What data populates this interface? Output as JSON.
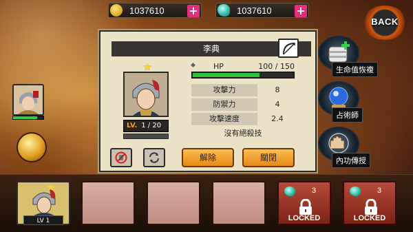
{
  "currency": {
    "gold": {
      "icon": "gold-coin-icon",
      "value": "1037610",
      "plus": "+"
    },
    "gem": {
      "icon": "gem-icon",
      "value": "1037610",
      "plus": "+"
    }
  },
  "back_button": {
    "label": "BACK"
  },
  "side_buttons": [
    {
      "icon": "bandage-heal-icon",
      "label": "生命值恢複"
    },
    {
      "icon": "crystal-ball-icon",
      "label": "占術師"
    },
    {
      "icon": "fist-palm-icon",
      "label": "內功傳授"
    }
  ],
  "dialog": {
    "title": "李典",
    "level_label": "LV.",
    "level_value": "1 / 20",
    "hp": {
      "label": "HP",
      "value": "100 / 150",
      "ratio": 0.667
    },
    "stats": [
      {
        "name": "攻擊力",
        "value": "8"
      },
      {
        "name": "防禦力",
        "value": "4"
      },
      {
        "name": "攻擊速度",
        "value": "2.4"
      }
    ],
    "skill_text": "沒有絕殺技",
    "buttons": {
      "dismiss": "解除",
      "close": "關閉"
    }
  },
  "bottom_slots": {
    "active_level": "LV 1",
    "locked": [
      {
        "cost": "3",
        "label": "LOCKED"
      },
      {
        "cost": "3",
        "label": "LOCKED"
      }
    ]
  },
  "colors": {
    "accent_orange": "#e58a18",
    "hp_green": "#2ec43a",
    "plus_pink": "#e0307a",
    "dialog_bg": "#ece2c6"
  }
}
